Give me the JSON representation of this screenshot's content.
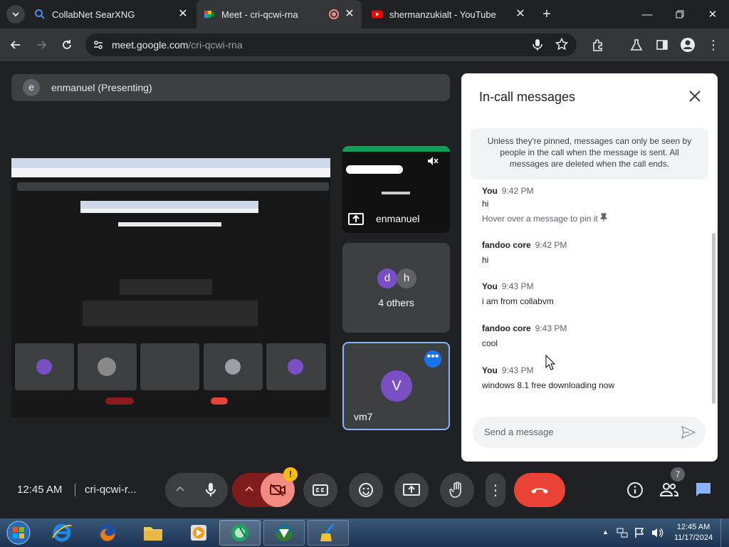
{
  "browser": {
    "tabs": [
      {
        "title": "CollabNet SearXNG",
        "favicon": "search-icon"
      },
      {
        "title": "Meet - cri-qcwi-rna",
        "favicon": "meet-icon",
        "active": true,
        "recording": true
      },
      {
        "title": "shermanzukialt - YouTube",
        "favicon": "youtube-icon"
      }
    ],
    "url_domain": "meet.google.com",
    "url_path": "/cri-qcwi-rna"
  },
  "meet": {
    "presenter_avatar_letter": "e",
    "presenting_label": "enmanuel (Presenting)",
    "presenter_tile_name": "enmanuel",
    "others": {
      "avatars": [
        "d",
        "h"
      ],
      "label": "4 others"
    },
    "self_tile": {
      "avatar_letter": "V",
      "name": "vm7"
    }
  },
  "chat": {
    "title": "In-call messages",
    "notice": "Unless they're pinned, messages can only be seen by people in the call when the message is sent. All messages are deleted when the call ends.",
    "pin_hint": "Hover over a message to pin it",
    "messages": [
      {
        "sender": "You",
        "time": "9:42 PM",
        "text": "hi"
      },
      {
        "sender": "fandoo core",
        "time": "9:42 PM",
        "text": "hi"
      },
      {
        "sender": "You",
        "time": "9:43 PM",
        "text": "i am from collabvm"
      },
      {
        "sender": "fandoo core",
        "time": "9:43 PM",
        "text": "cool"
      },
      {
        "sender": "You",
        "time": "9:43 PM",
        "text": "windows 8.1 free downloading now"
      }
    ],
    "input_placeholder": "Send a message"
  },
  "controls": {
    "time": "12:45 AM",
    "meeting_code": "cri-qcwi-r...",
    "participant_count": "7",
    "camera_warning": "!"
  },
  "taskbar": {
    "time": "12:45 AM",
    "date": "11/17/2024"
  },
  "colors": {
    "accent_blue": "#8ab4f8",
    "end_call_red": "#ea4335",
    "camera_off_bg": "#f28b82",
    "self_avatar": "#7b4fc4"
  }
}
